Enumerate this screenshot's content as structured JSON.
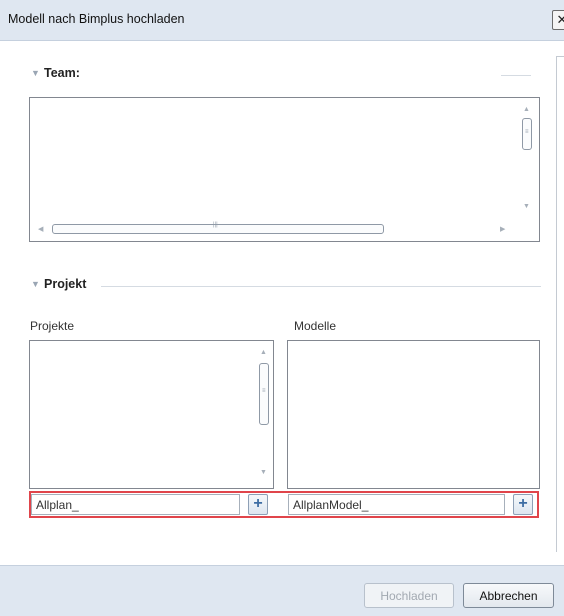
{
  "window": {
    "title": "Modell nach Bimplus hochladen",
    "close_glyph": "✕"
  },
  "team": {
    "label": "Team:"
  },
  "projekt": {
    "label": "Projekt",
    "projects_label": "Projekte",
    "models_label": "Modelle",
    "project_input_value": "Allplan_",
    "model_input_value": "AllplanModel_"
  },
  "footer": {
    "upload_label": "Hochladen",
    "cancel_label": "Abbrechen"
  },
  "icons": {
    "plus": "plus-icon",
    "close": "close-icon",
    "collapse": "triangle-down-icon"
  },
  "colors": {
    "highlight": "#e0454b",
    "chrome": "#dfe7f1"
  }
}
